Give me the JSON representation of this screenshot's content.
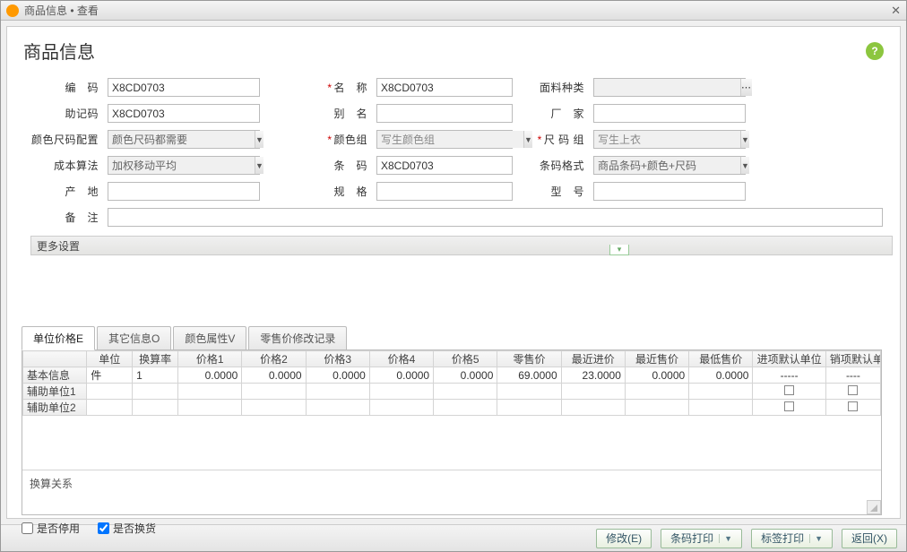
{
  "window": {
    "title": "商品信息 • 查看"
  },
  "header": {
    "title": "商品信息"
  },
  "form": {
    "code_label": "编　码",
    "code_value": "X8CD0703",
    "name_label": "名　称",
    "name_value": "X8CD0703",
    "material_label": "面料种类",
    "material_value": "",
    "mnemonic_label": "助记码",
    "mnemonic_value": "X8CD0703",
    "alias_label": "别　名",
    "alias_value": "",
    "factory_label": "厂　家",
    "factory_value": "",
    "colorsize_cfg_label": "颜色尺码配置",
    "colorsize_cfg_value": "颜色尺码都需要",
    "colorgroup_label": "颜色组",
    "colorgroup_value": "写生颜色组",
    "sizegroup_label": "尺 码 组",
    "sizegroup_value": "写生上衣",
    "cost_label": "成本算法",
    "cost_value": "加权移动平均",
    "barcode_label": "条　码",
    "barcode_value": "X8CD0703",
    "barcode_fmt_label": "条码格式",
    "barcode_fmt_value": "商品条码+颜色+尺码",
    "origin_label": "产　地",
    "origin_value": "",
    "spec_label": "规　格",
    "spec_value": "",
    "model_label": "型　号",
    "model_value": "",
    "remark_label": "备　注",
    "remark_value": "",
    "more_label": "更多设置"
  },
  "tabs": {
    "unit_price": "单位价格E",
    "other_info": "其它信息O",
    "color_attr": "颜色属性V",
    "retail_history": "零售价修改记录"
  },
  "grid": {
    "headers": {
      "blank": "",
      "unit": "单位",
      "rate": "换算率",
      "price1": "价格1",
      "price2": "价格2",
      "price3": "价格3",
      "price4": "价格4",
      "price5": "价格5",
      "retail": "零售价",
      "last_in": "最近进价",
      "last_out": "最近售价",
      "min_out": "最低售价",
      "def_in_unit": "进项默认单位",
      "def_out_unit": "销项默认单"
    },
    "rows": [
      {
        "h": "基本信息",
        "unit": "件",
        "rate": "1",
        "p1": "0.0000",
        "p2": "0.0000",
        "p3": "0.0000",
        "p4": "0.0000",
        "p5": "0.0000",
        "retail": "69.0000",
        "lastin": "23.0000",
        "lastout": "0.0000",
        "minout": "0.0000",
        "din": "-----",
        "dout": "----"
      },
      {
        "h": "辅助单位1",
        "unit": "",
        "rate": "",
        "p1": "",
        "p2": "",
        "p3": "",
        "p4": "",
        "p5": "",
        "retail": "",
        "lastin": "",
        "lastout": "",
        "minout": "",
        "din": "chk",
        "dout": "chk"
      },
      {
        "h": "辅助单位2",
        "unit": "",
        "rate": "",
        "p1": "",
        "p2": "",
        "p3": "",
        "p4": "",
        "p5": "",
        "retail": "",
        "lastin": "",
        "lastout": "",
        "minout": "",
        "din": "chk",
        "dout": "chk"
      }
    ],
    "exchange_label": "换算关系"
  },
  "checks": {
    "discontinued": "是否停用",
    "exchangeable": "是否换货"
  },
  "footer": {
    "modify": "修改(E)",
    "barcode_print": "条码打印",
    "tag_print": "标签打印",
    "back": "返回(X)"
  }
}
